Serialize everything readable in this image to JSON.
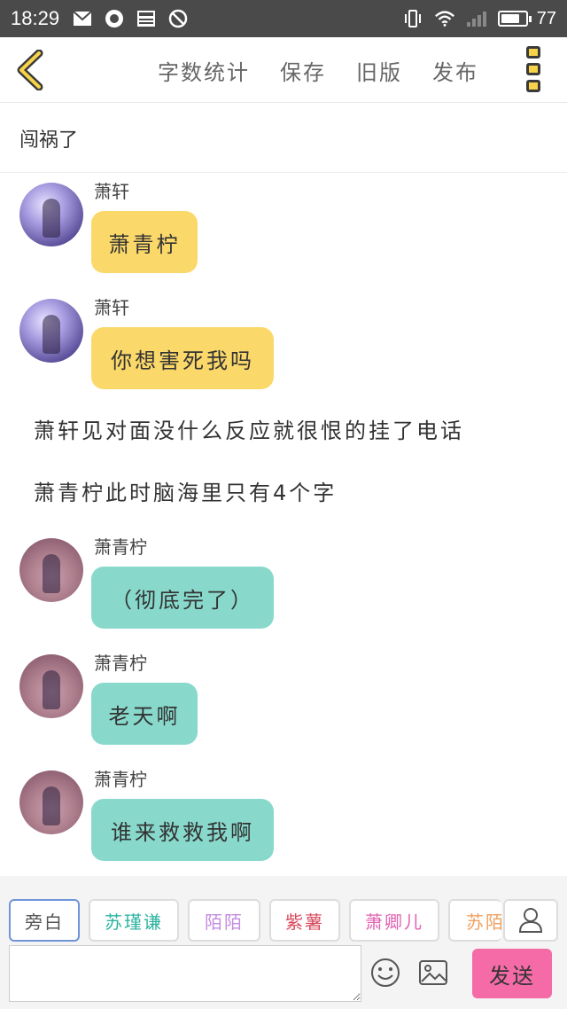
{
  "status_bar": {
    "time": "18:29",
    "battery_level": 77,
    "battery_text": "77",
    "left_icons": [
      "mail-icon",
      "app-icon",
      "news-icon",
      "block-icon"
    ],
    "right_icons": [
      "vibrate-icon",
      "wifi-icon",
      "signal-icon",
      "battery-icon"
    ]
  },
  "toolbar": {
    "actions": [
      "字数统计",
      "保存",
      "旧版",
      "发布"
    ]
  },
  "title": "闯祸了",
  "messages": [
    {
      "sender": "萧轩",
      "text": "萧青柠",
      "color": "#fbd86a"
    },
    {
      "sender": "萧轩",
      "text": "你想害死我吗",
      "color": "#fbd86a"
    }
  ],
  "narrations": [
    "萧轩见对面没什么反应就很恨的挂了电话",
    "萧青柠此时脑海里只有4个字"
  ],
  "messages2": [
    {
      "sender": "萧青柠",
      "text": "（彻底完了）",
      "color": "#88d9cc"
    },
    {
      "sender": "萧青柠",
      "text": "老天啊",
      "color": "#88d9cc"
    },
    {
      "sender": "萧青柠",
      "text": "谁来救救我啊",
      "color": "#88d9cc"
    }
  ],
  "roles": [
    {
      "label": "旁白",
      "color": "#555555"
    },
    {
      "label": "苏瑾谦",
      "color": "#2bb3a0"
    },
    {
      "label": "陌陌",
      "color": "#c58be0"
    },
    {
      "label": "紫薯",
      "color": "#d8485c"
    },
    {
      "label": "萧卿儿",
      "color": "#e060b0"
    },
    {
      "label": "苏陌",
      "color": "#f0a060"
    }
  ],
  "input": {
    "placeholder": "",
    "value": "",
    "send_label": "发送"
  },
  "colors": {
    "accent_send": "#f56ba8",
    "bubble_yellow": "#fbd86a",
    "bubble_teal": "#88d9cc",
    "icon_yellow": "#f7d34a"
  }
}
